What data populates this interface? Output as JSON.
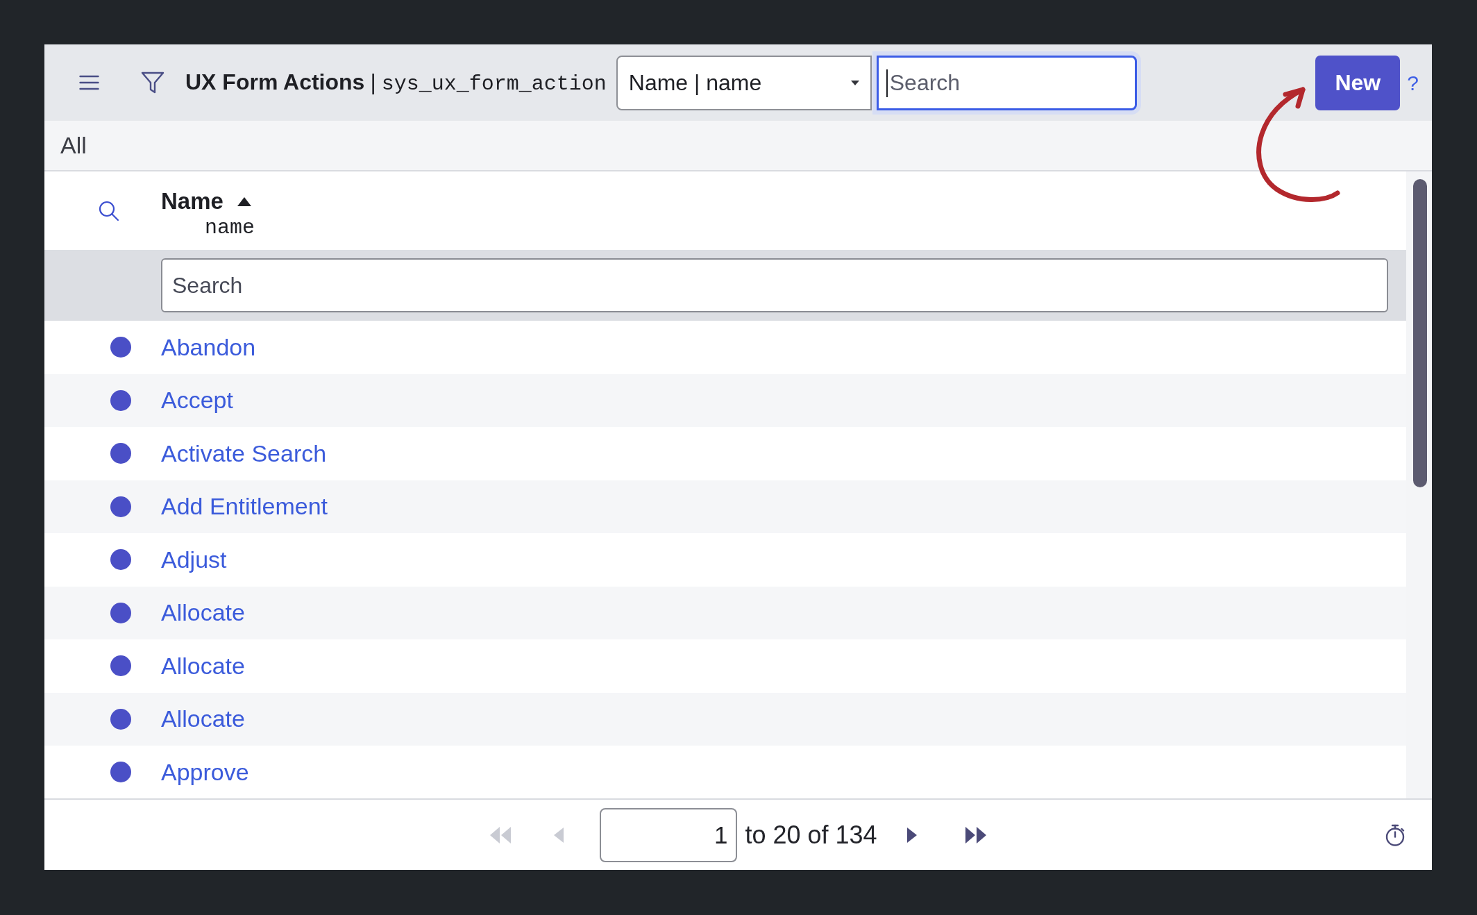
{
  "header": {
    "title": "UX Form Actions",
    "separator": "|",
    "table_name": "sys_ux_form_action",
    "field_select": {
      "value": "Name | name"
    },
    "search": {
      "placeholder": "Search",
      "focused": true
    },
    "new_button": "New",
    "help": "?"
  },
  "breadcrumb": {
    "label": "All"
  },
  "table": {
    "columns": [
      {
        "label": "Name",
        "field": "name",
        "sorted": true,
        "descending": false
      }
    ],
    "column_search": {
      "placeholder": "Search"
    },
    "rows": [
      {
        "name": "Abandon"
      },
      {
        "name": "Accept"
      },
      {
        "name": "Activate Search"
      },
      {
        "name": "Add Entitlement"
      },
      {
        "name": "Adjust"
      },
      {
        "name": "Allocate"
      },
      {
        "name": "Allocate"
      },
      {
        "name": "Allocate"
      },
      {
        "name": "Approve"
      }
    ]
  },
  "pagination": {
    "controls": [
      {
        "kind": "first",
        "disabled": true
      },
      {
        "kind": "previous",
        "disabled": true
      },
      {
        "kind": "page_input",
        "value": "1"
      },
      {
        "kind": "range",
        "text": "to 20 of 134"
      },
      {
        "kind": "next",
        "disabled": false
      },
      {
        "kind": "last",
        "disabled": false
      }
    ]
  },
  "annotations": [
    {
      "kind": "curved_arrow"
    }
  ]
}
